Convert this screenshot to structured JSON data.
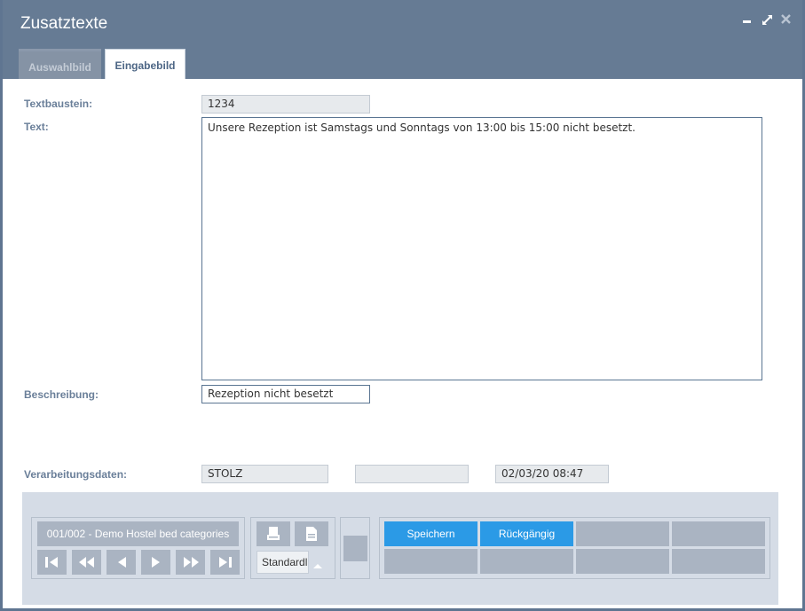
{
  "window": {
    "title": "Zusatztexte",
    "controls": [
      "minimize-icon",
      "maximize-icon",
      "close-icon"
    ]
  },
  "tabs": [
    {
      "label": "Auswahlbild",
      "active": false
    },
    {
      "label": "Eingabebild",
      "active": true
    }
  ],
  "form": {
    "textbaustein_label": "Textbaustein:",
    "textbaustein_value": "1234",
    "text_label": "Text:",
    "text_value": "Unsere Rezeption ist Samstags und Sonntags von 13:00 bis 15:00 nicht besetzt.",
    "beschreibung_label": "Beschreibung:",
    "beschreibung_value": "Rezeption nicht besetzt",
    "verarbeitung_label": "Verarbeitungsdaten:",
    "verarbeitung_user": "STOLZ",
    "verarbeitung_blank": "",
    "verarbeitung_datetime": "02/03/20 08:47"
  },
  "footer": {
    "record_label": "001/002 - Demo Hostel bed categories",
    "nav_icons": [
      "first-icon",
      "fast-back-icon",
      "prev-icon",
      "next-icon",
      "fast-forward-icon",
      "last-icon"
    ],
    "print_icons": [
      "print-icon",
      "document-icon"
    ],
    "layout_select": "Standardli",
    "actions": {
      "save": "Speichern",
      "undo": "Rückgängig"
    }
  },
  "colors": {
    "titlebar": "#667b94",
    "accent": "#2b9ae6",
    "label": "#6a7f99"
  }
}
